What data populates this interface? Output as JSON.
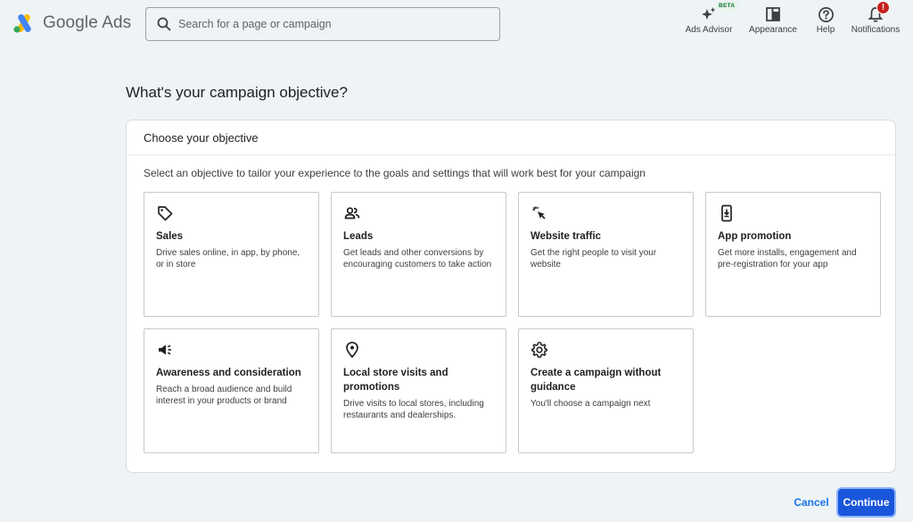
{
  "header": {
    "logo_text": "Google Ads",
    "search_placeholder": "Search for a page or campaign",
    "actions": [
      {
        "label": "Ads Advisor",
        "badge": "BETA",
        "icon": "sparkle-icon"
      },
      {
        "label": "Appearance",
        "icon": "appearance-icon"
      },
      {
        "label": "Help",
        "icon": "help-icon"
      },
      {
        "label": "Notifications",
        "badge": "!",
        "icon": "bell-icon"
      }
    ]
  },
  "page": {
    "title": "What's your campaign objective?"
  },
  "card": {
    "heading": "Choose your objective",
    "description": "Select an objective to tailor your experience to the goals and settings that will work best for your campaign",
    "objectives": [
      {
        "title": "Sales",
        "description": "Drive sales online, in app, by phone, or in store",
        "icon": "tag-icon"
      },
      {
        "title": "Leads",
        "description": "Get leads and other conversions by encouraging customers to take action",
        "icon": "people-icon"
      },
      {
        "title": "Website traffic",
        "description": "Get the right people to visit your website",
        "icon": "cursor-click-icon"
      },
      {
        "title": "App promotion",
        "description": "Get more installs, engagement and pre-registration for your app",
        "icon": "phone-download-icon"
      },
      {
        "title": "Awareness and consideration",
        "description": "Reach a broad audience and build interest in your products or brand",
        "icon": "megaphone-icon"
      },
      {
        "title": "Local store visits and promotions",
        "description": "Drive visits to local stores, including restaurants and dealerships.",
        "icon": "location-pin-icon"
      },
      {
        "title": "Create a campaign without guidance",
        "description": "You'll choose a campaign next",
        "icon": "gear-icon"
      }
    ]
  },
  "footer": {
    "cancel_label": "Cancel",
    "continue_label": "Continue"
  },
  "colors": {
    "background": "#eef3f6",
    "accent": "#1a56db",
    "link": "#1a73e8",
    "badge_red": "#c5221f"
  }
}
